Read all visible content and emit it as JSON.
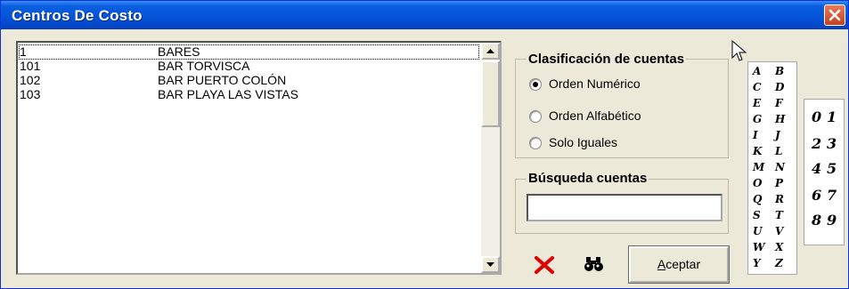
{
  "window": {
    "title": "Centros De Costo"
  },
  "list": {
    "rows": [
      {
        "code": "1",
        "name": "BARES",
        "selected": true
      },
      {
        "code": "101",
        "name": "BAR TORVISCA",
        "selected": false
      },
      {
        "code": "102",
        "name": "BAR PUERTO COLÓN",
        "selected": false
      },
      {
        "code": "103",
        "name": "BAR PLAYA LAS VISTAS",
        "selected": false
      }
    ]
  },
  "classification": {
    "title": "Clasificación de cuentas",
    "options": [
      {
        "label": "Orden Numérico",
        "checked": true
      },
      {
        "label": "Orden Alfabético",
        "checked": false
      },
      {
        "label": "Solo Iguales",
        "checked": false
      }
    ]
  },
  "search": {
    "title": "Búsqueda cuentas",
    "value": ""
  },
  "buttons": {
    "delete_icon": "red-x-icon",
    "find_icon": "binoculars-icon",
    "accept_label": "ceptar",
    "accept_mnemonic": "A"
  },
  "letters": [
    "A",
    "B",
    "C",
    "D",
    "E",
    "F",
    "G",
    "H",
    "I",
    "J",
    "K",
    "L",
    "M",
    "N",
    "O",
    "P",
    "Q",
    "R",
    "S",
    "T",
    "U",
    "V",
    "W",
    "X",
    "Y",
    "Z"
  ],
  "digits": [
    "0",
    "1",
    "2",
    "3",
    "4",
    "5",
    "6",
    "7",
    "8",
    "9"
  ],
  "colors": {
    "titlebar": "#0454d8",
    "face": "#ece9d8",
    "close": "#d8532e",
    "delete": "#e00000"
  }
}
